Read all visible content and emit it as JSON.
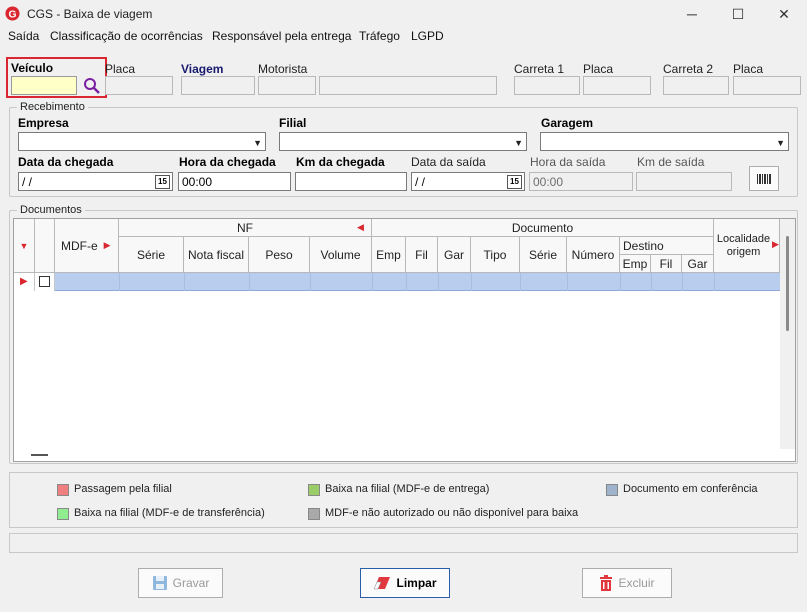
{
  "window": {
    "title": "CGS - Baixa de viagem",
    "minimize": "─",
    "maximize": "☐",
    "close": "✕"
  },
  "menu": [
    "Saída",
    "Classificação de ocorrências",
    "Responsável pela entrega",
    "Tráfego",
    "LGPD"
  ],
  "vehicle": {
    "veiculo_label": "Veículo",
    "placa_label": "Placa",
    "viagem_label": "Viagem",
    "motorista_label": "Motorista",
    "carreta1_label": "Carreta 1",
    "placa1_label": "Placa",
    "carreta2_label": "Carreta 2",
    "placa2_label": "Placa"
  },
  "recebimento": {
    "group_title": "Recebimento",
    "empresa_label": "Empresa",
    "filial_label": "Filial",
    "garagem_label": "Garagem",
    "data_chegada_label": "Data da chegada",
    "data_chegada_value": " / /",
    "hora_chegada_label": "Hora da chegada",
    "hora_chegada_value": "00:00",
    "km_chegada_label": "Km da chegada",
    "data_saida_label": "Data da saída",
    "data_saida_value": " / /",
    "hora_saida_label": "Hora da saída",
    "hora_saida_value": "00:00",
    "km_saida_label": "Km de saída",
    "calendar_glyph": "15"
  },
  "documentos": {
    "group_title": "Documentos",
    "headers": {
      "mdfe": "MDF-e",
      "nf": "NF",
      "documento": "Documento",
      "localidade": "Localidade origem",
      "serie": "Série",
      "nota_fiscal": "Nota fiscal",
      "peso": "Peso",
      "volume": "Volume",
      "emp": "Emp",
      "fil": "Fil",
      "gar": "Gar",
      "tipo": "Tipo",
      "serie2": "Série",
      "numero": "Número",
      "destino": "Destino",
      "dest_emp": "Emp",
      "dest_fil": "Fil",
      "dest_gar": "Gar"
    }
  },
  "legend": {
    "items": [
      {
        "label": "Passagem pela filial",
        "color": "#f08080"
      },
      {
        "label": "Baixa na filial (MDF-e de entrega)",
        "color": "#9acd68"
      },
      {
        "label": "Documento em conferência",
        "color": "#9fb4cc"
      },
      {
        "label": "Baixa na filial (MDF-e de transferência)",
        "color": "#90ee90"
      },
      {
        "label": "MDF-e não autorizado ou não disponível para baixa",
        "color": "#a9a9a9"
      }
    ]
  },
  "buttons": {
    "gravar": "Gravar",
    "limpar": "Limpar",
    "excluir": "Excluir"
  },
  "colors": {
    "accent_red": "#d9262f",
    "row_selected": "#b9cdef",
    "input_yellow": "#ffffc8"
  }
}
